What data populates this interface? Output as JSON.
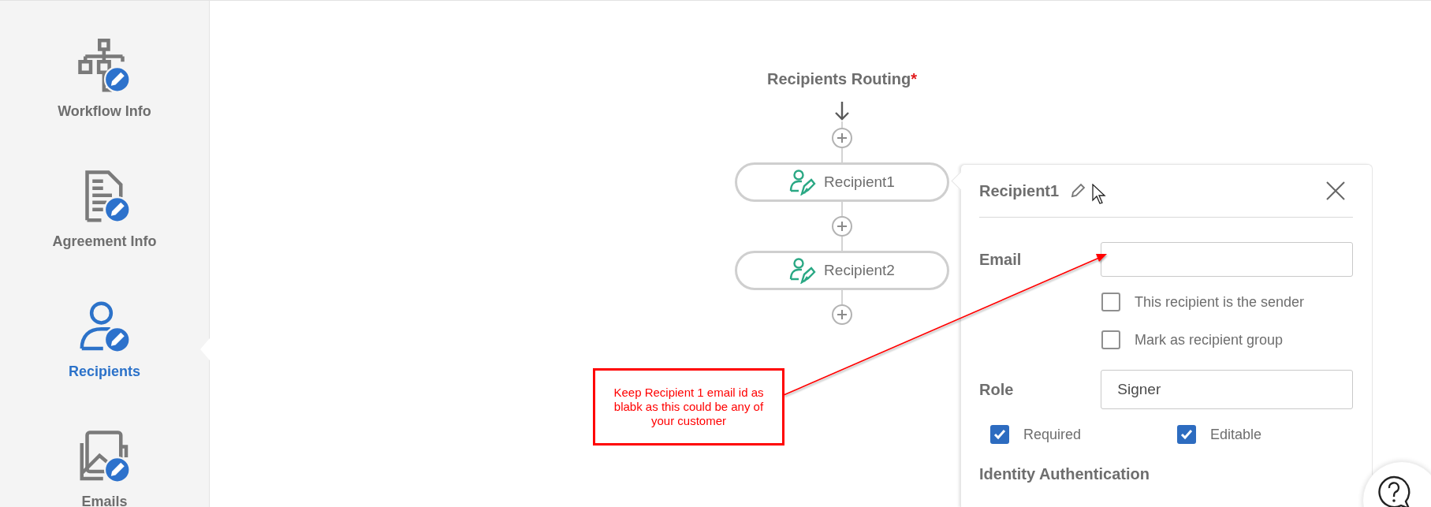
{
  "sidebar": {
    "items": [
      {
        "label": "Workflow Info",
        "kind": "workflow",
        "selected": false
      },
      {
        "label": "Agreement Info",
        "kind": "document",
        "selected": false
      },
      {
        "label": "Recipients",
        "kind": "person",
        "selected": true
      },
      {
        "label": "Emails",
        "kind": "email",
        "selected": false
      }
    ]
  },
  "routing": {
    "title": "Recipients Routing",
    "required_mark": "*",
    "recipients": [
      {
        "name": "Recipient1"
      },
      {
        "name": "Recipient2"
      }
    ]
  },
  "panel": {
    "title": "Recipient1",
    "email": {
      "label": "Email"
    },
    "email_options": [
      {
        "label": "This recipient is the sender",
        "checked": false
      },
      {
        "label": "Mark as recipient group",
        "checked": false
      }
    ],
    "role": {
      "label": "Role",
      "value": "Signer"
    },
    "role_options": [
      {
        "label": "Required",
        "checked": true
      },
      {
        "label": "Editable",
        "checked": true
      }
    ],
    "section": "Identity Authentication"
  },
  "annotation": {
    "text": "Keep Recipient 1 email id as blabk as this could be any of your customer"
  }
}
